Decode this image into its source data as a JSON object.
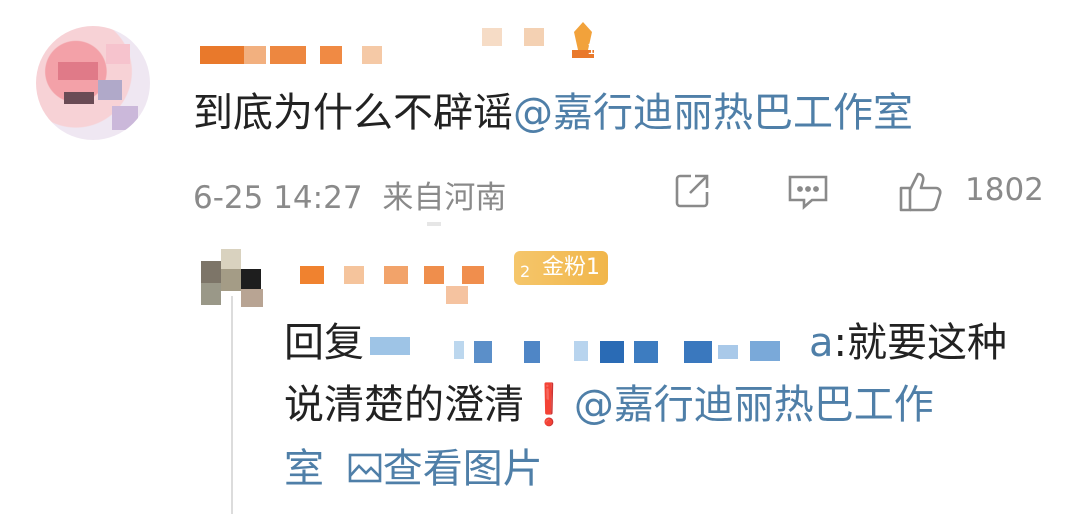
{
  "comment": {
    "text": "到底为什么不辟谣",
    "mention": "@嘉行迪丽热巴工作室",
    "time": "6-25 14:27",
    "location": "来自河南",
    "like_count": "1802",
    "level_badge": "1"
  },
  "reply": {
    "prefix": "回复",
    "username_suffix": "a",
    "text_after": ":就要这种",
    "line2": "说清楚的澄清",
    "exclaim": "❗",
    "mention": "@嘉行迪丽热巴工作",
    "line3_start": "室",
    "view_image": "查看图片",
    "badge_level": "2",
    "badge_text": "金粉1"
  },
  "icons": [
    "share-icon",
    "comment-icon",
    "like-icon",
    "image-icon"
  ],
  "colors": {
    "mention": "#4f7fa8",
    "meta": "#8a8a8a",
    "text": "#222222",
    "badge": "#f1b64a"
  }
}
